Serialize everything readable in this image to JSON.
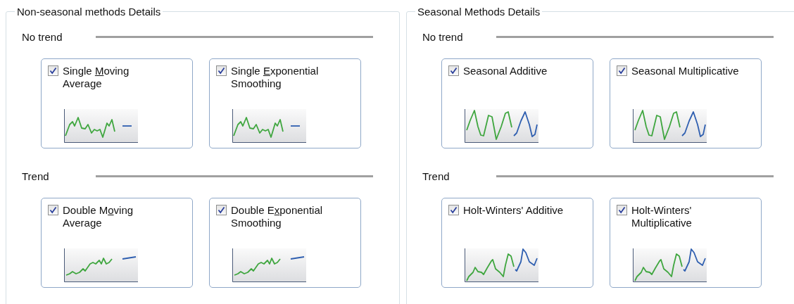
{
  "groups": [
    {
      "title": "Non-seasonal methods Details",
      "sections": [
        {
          "heading": "No trend",
          "methods": [
            {
              "checked": true,
              "kind": "flat",
              "lines": [
                [
                  {
                    "text": "Single ",
                    "underlined": false
                  },
                  {
                    "text": "M",
                    "underlined": true
                  },
                  {
                    "text": "oving",
                    "underlined": false
                  }
                ],
                [
                  {
                    "text": "Average",
                    "underlined": false
                  }
                ]
              ]
            },
            {
              "checked": true,
              "kind": "flat",
              "lines": [
                [
                  {
                    "text": "Single ",
                    "underlined": false
                  },
                  {
                    "text": "E",
                    "underlined": true
                  },
                  {
                    "text": "xponential",
                    "underlined": false
                  }
                ],
                [
                  {
                    "text": "Smoothing",
                    "underlined": false
                  }
                ]
              ]
            }
          ]
        },
        {
          "heading": "Trend",
          "methods": [
            {
              "checked": true,
              "kind": "trend",
              "lines": [
                [
                  {
                    "text": "Double M",
                    "underlined": false
                  },
                  {
                    "text": "o",
                    "underlined": true
                  },
                  {
                    "text": "ving",
                    "underlined": false
                  }
                ],
                [
                  {
                    "text": "Average",
                    "underlined": false
                  }
                ]
              ]
            },
            {
              "checked": true,
              "kind": "trend",
              "lines": [
                [
                  {
                    "text": "Double E",
                    "underlined": false
                  },
                  {
                    "text": "x",
                    "underlined": true
                  },
                  {
                    "text": "ponential",
                    "underlined": false
                  }
                ],
                [
                  {
                    "text": "Smoothing",
                    "underlined": false
                  }
                ]
              ]
            }
          ]
        }
      ]
    },
    {
      "title": "Seasonal Methods Details",
      "sections": [
        {
          "heading": "No trend",
          "methods": [
            {
              "checked": true,
              "kind": "seasonal",
              "lines": [
                [
                  {
                    "text": "Seasonal Additive",
                    "underlined": false
                  }
                ]
              ]
            },
            {
              "checked": true,
              "kind": "seasonal",
              "lines": [
                [
                  {
                    "text": "Seasonal Multiplicative",
                    "underlined": false
                  }
                ]
              ]
            }
          ]
        },
        {
          "heading": "Trend",
          "methods": [
            {
              "checked": true,
              "kind": "seasonal_trend",
              "lines": [
                [
                  {
                    "text": "Holt-Winters' Additive",
                    "underlined": false
                  }
                ]
              ]
            },
            {
              "checked": true,
              "kind": "seasonal_trend",
              "lines": [
                [
                  {
                    "text": "Holt-Winters'",
                    "underlined": false
                  }
                ],
                [
                  {
                    "text": "Multiplicative",
                    "underlined": false
                  }
                ]
              ]
            }
          ]
        }
      ]
    }
  ]
}
